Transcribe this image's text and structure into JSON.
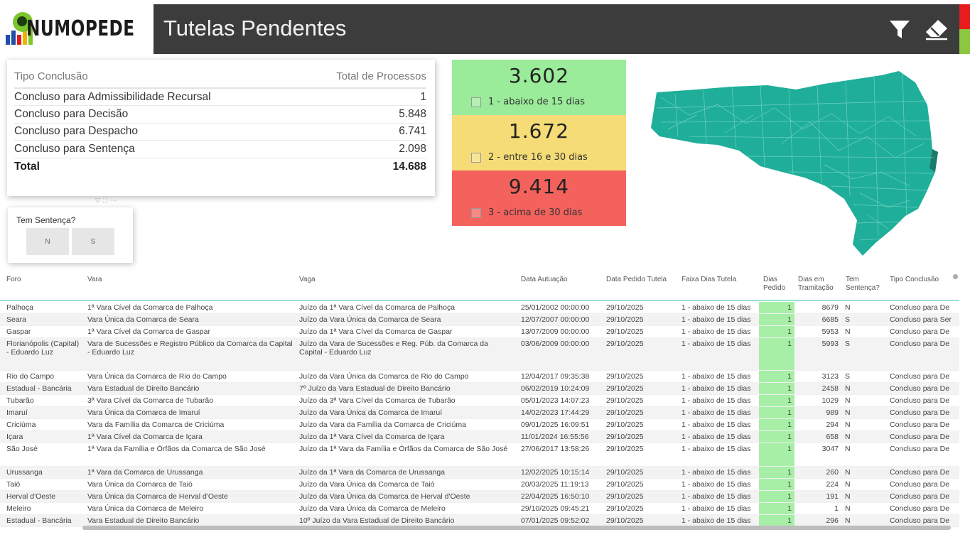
{
  "brand": {
    "name": "NUMOPEDE"
  },
  "header": {
    "title": "Tutelas Pendentes",
    "filter_icon": "filter-icon",
    "clear_icon": "eraser-icon",
    "accent_red": "#e51d1d",
    "accent_green": "#8dc63f",
    "bar_color": "#3c3c3c"
  },
  "summary": {
    "col_tipo": "Tipo Conclusão",
    "col_total": "Total de Processos",
    "rows": [
      {
        "tipo": "Concluso para Admissibilidade Recursal",
        "total": "1"
      },
      {
        "tipo": "Concluso para Decisão",
        "total": "5.848"
      },
      {
        "tipo": "Concluso para Despacho",
        "total": "6.741"
      },
      {
        "tipo": "Concluso para Sentença",
        "total": "2.098"
      }
    ],
    "total_label": "Total",
    "total_value": "14.688"
  },
  "slicer": {
    "title": "Tem Sentença?",
    "options": [
      "N",
      "S"
    ]
  },
  "kpis": [
    {
      "value": "3.602",
      "label": "1 - abaixo de 15 dias",
      "color": "#9aeb9a"
    },
    {
      "value": "1.672",
      "label": "2 - entre 16 e 30 dias",
      "color": "#f6dc76"
    },
    {
      "value": "9.414",
      "label": "3 - acima de 30 dias",
      "color": "#f3625d"
    }
  ],
  "map": {
    "fill": "#1fae99",
    "highlight": "#1b7a6c"
  },
  "detail": {
    "headers": {
      "foro": "Foro",
      "vara": "Vara",
      "vaga": "Vaga",
      "data_autuacao": "Data Autuação",
      "data_pedido": "Data Pedido Tutela",
      "faixa": "Faixa Dias Tutela",
      "dias_pedido": "Dias Pedido",
      "dias_tramitacao": "Dias em Tramitação",
      "tem_sentenca": "Tem Sentença?",
      "tipo_conclusao": "Tipo Conclusão"
    },
    "rows": [
      {
        "foro": "Palhoça",
        "vara": "1ª Vara Cível da Comarca de Palhoça",
        "vaga": "Juízo da 1ª Vara Cível da Comarca de Palhoça",
        "data_autuacao": "25/01/2002 00:00:00",
        "data_pedido": "29/10/2025",
        "faixa": "1 - abaixo de 15 dias",
        "dias_pedido": "1",
        "dias_tramitacao": "8679",
        "tem_sentenca": "N",
        "tipo_conclusao": "Concluso para De"
      },
      {
        "foro": "Seara",
        "vara": "Vara Única da Comarca de Seara",
        "vaga": "Juízo da Vara Única da Comarca de Seara",
        "data_autuacao": "12/07/2007 00:00:00",
        "data_pedido": "29/10/2025",
        "faixa": "1 - abaixo de 15 dias",
        "dias_pedido": "1",
        "dias_tramitacao": "6685",
        "tem_sentenca": "S",
        "tipo_conclusao": "Concluso para Ser"
      },
      {
        "foro": "Gaspar",
        "vara": "1ª Vara Cível da Comarca de Gaspar",
        "vaga": "Juízo da 1ª Vara Cível da Comarca de Gaspar",
        "data_autuacao": "13/07/2009 00:00:00",
        "data_pedido": "29/10/2025",
        "faixa": "1 - abaixo de 15 dias",
        "dias_pedido": "1",
        "dias_tramitacao": "5953",
        "tem_sentenca": "N",
        "tipo_conclusao": "Concluso para De"
      },
      {
        "foro": "Florianópolis (Capital) - Eduardo Luz",
        "vara": "Vara de Sucessões e Registro Público da Comarca da Capital - Eduardo Luz",
        "vaga": "Juízo da Vara de Sucessões e Reg. Púb. da Comarca da Capital - Eduardo Luz",
        "data_autuacao": "03/06/2009 00:00:00",
        "data_pedido": "29/10/2025",
        "faixa": "1 - abaixo de 15 dias",
        "dias_pedido": "1",
        "dias_tramitacao": "5993",
        "tem_sentenca": "S",
        "tipo_conclusao": "Concluso para De"
      },
      {
        "foro": "Rio do Campo",
        "vara": "Vara Única da Comarca de Rio do Campo",
        "vaga": "Juízo da Vara Única da Comarca de Rio do Campo",
        "data_autuacao": "12/04/2017 09:35:38",
        "data_pedido": "29/10/2025",
        "faixa": "1 - abaixo de 15 dias",
        "dias_pedido": "1",
        "dias_tramitacao": "3123",
        "tem_sentenca": "S",
        "tipo_conclusao": "Concluso para De"
      },
      {
        "foro": "Estadual - Bancária",
        "vara": "Vara Estadual de Direito Bancário",
        "vaga": "7º Juízo da Vara Estadual de Direito Bancário",
        "data_autuacao": "06/02/2019 10:24:09",
        "data_pedido": "29/10/2025",
        "faixa": "1 - abaixo de 15 dias",
        "dias_pedido": "1",
        "dias_tramitacao": "2458",
        "tem_sentenca": "N",
        "tipo_conclusao": "Concluso para De"
      },
      {
        "foro": "Tubarão",
        "vara": "3ª Vara Cível da Comarca de Tubarão",
        "vaga": "Juízo da 3ª Vara Cível da Comarca de Tubarão",
        "data_autuacao": "05/01/2023 14:07:23",
        "data_pedido": "29/10/2025",
        "faixa": "1 - abaixo de 15 dias",
        "dias_pedido": "1",
        "dias_tramitacao": "1029",
        "tem_sentenca": "N",
        "tipo_conclusao": "Concluso para De"
      },
      {
        "foro": "Imaruí",
        "vara": "Vara Única da Comarca de Imaruí",
        "vaga": "Juízo da Vara Única da Comarca de Imaruí",
        "data_autuacao": "14/02/2023 17:44:29",
        "data_pedido": "29/10/2025",
        "faixa": "1 - abaixo de 15 dias",
        "dias_pedido": "1",
        "dias_tramitacao": "989",
        "tem_sentenca": "N",
        "tipo_conclusao": "Concluso para De"
      },
      {
        "foro": "Criciúma",
        "vara": "Vara da Família da Comarca de Criciúma",
        "vaga": "Juízo da Vara da Família da Comarca de Criciúma",
        "data_autuacao": "09/01/2025 16:09:51",
        "data_pedido": "29/10/2025",
        "faixa": "1 - abaixo de 15 dias",
        "dias_pedido": "1",
        "dias_tramitacao": "294",
        "tem_sentenca": "N",
        "tipo_conclusao": "Concluso para De"
      },
      {
        "foro": "Içara",
        "vara": "1ª Vara Cível da Comarca de Içara",
        "vaga": "Juízo da 1ª Vara Cível da Comarca de Içara",
        "data_autuacao": "11/01/2024 16:55:56",
        "data_pedido": "29/10/2025",
        "faixa": "1 - abaixo de 15 dias",
        "dias_pedido": "1",
        "dias_tramitacao": "658",
        "tem_sentenca": "N",
        "tipo_conclusao": "Concluso para De"
      },
      {
        "foro": "São José",
        "vara": "1ª Vara da Família e Órfãos da Comarca de São José",
        "vaga": "Juízo da 1ª Vara da Família e Órfãos da Comarca de São José",
        "data_autuacao": "27/06/2017 13:58:26",
        "data_pedido": "29/10/2025",
        "faixa": "1 - abaixo de 15 dias",
        "dias_pedido": "1",
        "dias_tramitacao": "3047",
        "tem_sentenca": "N",
        "tipo_conclusao": "Concluso para De"
      },
      {
        "foro": "Urussanga",
        "vara": "1ª Vara da Comarca de Urussanga",
        "vaga": "Juízo da 1ª Vara da Comarca de Urussanga",
        "data_autuacao": "12/02/2025 10:15:14",
        "data_pedido": "29/10/2025",
        "faixa": "1 - abaixo de 15 dias",
        "dias_pedido": "1",
        "dias_tramitacao": "260",
        "tem_sentenca": "N",
        "tipo_conclusao": "Concluso para De"
      },
      {
        "foro": "Taió",
        "vara": "Vara Única da Comarca de Taió",
        "vaga": "Juízo da Vara Única da Comarca de Taió",
        "data_autuacao": "20/03/2025 11:19:13",
        "data_pedido": "29/10/2025",
        "faixa": "1 - abaixo de 15 dias",
        "dias_pedido": "1",
        "dias_tramitacao": "224",
        "tem_sentenca": "N",
        "tipo_conclusao": "Concluso para De"
      },
      {
        "foro": "Herval d'Oeste",
        "vara": "Vara Única da Comarca de Herval d'Oeste",
        "vaga": "Juízo da Vara Única da Comarca de Herval d'Oeste",
        "data_autuacao": "22/04/2025 16:50:10",
        "data_pedido": "29/10/2025",
        "faixa": "1 - abaixo de 15 dias",
        "dias_pedido": "1",
        "dias_tramitacao": "191",
        "tem_sentenca": "N",
        "tipo_conclusao": "Concluso para De"
      },
      {
        "foro": "Meleiro",
        "vara": "Vara Única da Comarca de Meleiro",
        "vaga": "Juízo da Vara Única da Comarca de Meleiro",
        "data_autuacao": "29/10/2025 09:45:21",
        "data_pedido": "29/10/2025",
        "faixa": "1 - abaixo de 15 dias",
        "dias_pedido": "1",
        "dias_tramitacao": "1",
        "tem_sentenca": "N",
        "tipo_conclusao": "Concluso para De"
      },
      {
        "foro": "Estadual - Bancária",
        "vara": "Vara Estadual de Direito Bancário",
        "vaga": "10º Juízo da Vara Estadual de Direito Bancário",
        "data_autuacao": "07/01/2025 09:52:02",
        "data_pedido": "29/10/2025",
        "faixa": "1 - abaixo de 15 dias",
        "dias_pedido": "1",
        "dias_tramitacao": "296",
        "tem_sentenca": "N",
        "tipo_conclusao": "Concluso para De"
      }
    ]
  }
}
